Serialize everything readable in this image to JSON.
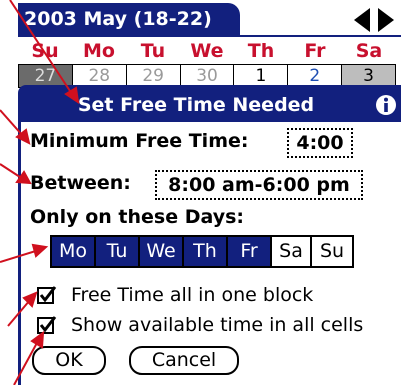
{
  "calendar": {
    "title": "2003 May (18-22)",
    "weekdays": [
      "Su",
      "Mo",
      "Tu",
      "We",
      "Th",
      "Fr",
      "Sa"
    ],
    "dates": [
      "27",
      "28",
      "29",
      "30",
      "1",
      "2",
      "3"
    ]
  },
  "dialog": {
    "title": "Set Free Time Needed",
    "min_free_label": "Minimum Free Time:",
    "min_free_value": "4:00",
    "between_label": "Between:",
    "between_value": "8:00 am-6:00 pm",
    "days_label": "Only on these Days:",
    "days": [
      {
        "label": "Mo",
        "selected": true
      },
      {
        "label": "Tu",
        "selected": true
      },
      {
        "label": "We",
        "selected": true
      },
      {
        "label": "Th",
        "selected": true
      },
      {
        "label": "Fr",
        "selected": true
      },
      {
        "label": "Sa",
        "selected": false
      },
      {
        "label": "Su",
        "selected": false
      }
    ],
    "checkbox_one_block": {
      "label": "Free Time all in one block",
      "checked": true
    },
    "checkbox_all_cells": {
      "label": "Show available time in all cells",
      "checked": true
    },
    "ok_label": "OK",
    "cancel_label": "Cancel"
  },
  "colors": {
    "accent": "#12207e",
    "weekday_text": "#c8102e",
    "callout": "#d0101e"
  }
}
